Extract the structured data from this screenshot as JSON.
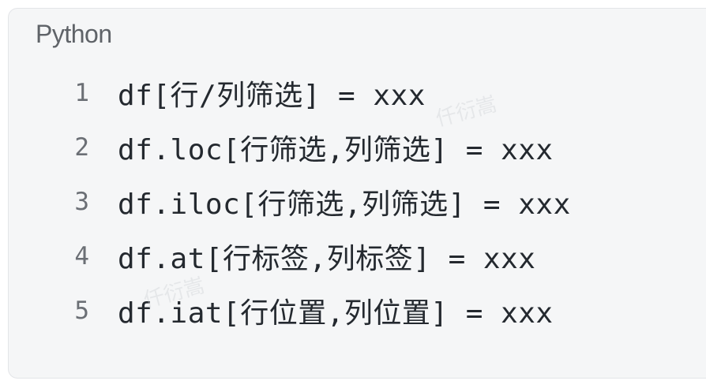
{
  "code_block": {
    "language": "Python",
    "lines": [
      {
        "number": "1",
        "code": "df[行/列筛选] = xxx"
      },
      {
        "number": "2",
        "code": "df.loc[行筛选,列筛选] = xxx"
      },
      {
        "number": "3",
        "code": "df.iloc[行筛选,列筛选] = xxx"
      },
      {
        "number": "4",
        "code": "df.at[行标签,列标签] = xxx"
      },
      {
        "number": "5",
        "code": "df.iat[行位置,列位置] = xxx"
      }
    ],
    "watermark": "仟衍嵩"
  }
}
